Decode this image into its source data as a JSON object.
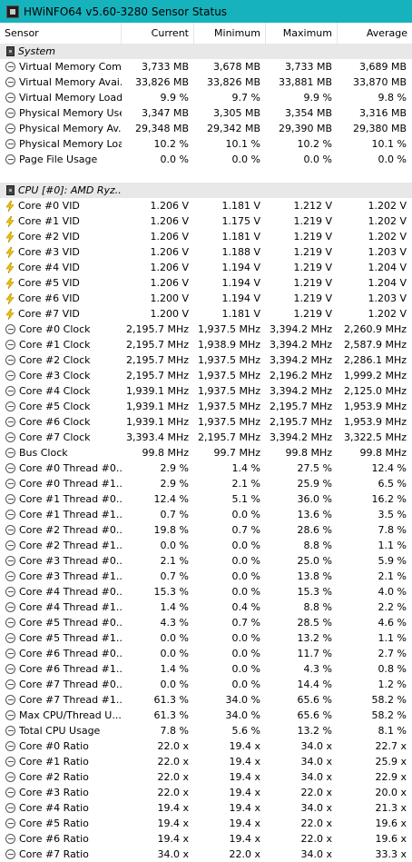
{
  "window": {
    "title": "HWiNFO64 v5.60-3280 Sensor Status"
  },
  "columns": {
    "sensor": "Sensor",
    "current": "Current",
    "minimum": "Minimum",
    "maximum": "Maximum",
    "average": "Average"
  },
  "rows": [
    {
      "kind": "group",
      "icon": "chip-icon",
      "name": "System",
      "cur": "",
      "min": "",
      "max": "",
      "avg": ""
    },
    {
      "kind": "item",
      "icon": "gauge-icon",
      "name": "Virtual Memory Com...",
      "cur": "3,733 MB",
      "min": "3,678 MB",
      "max": "3,733 MB",
      "avg": "3,689 MB"
    },
    {
      "kind": "item",
      "icon": "gauge-icon",
      "name": "Virtual Memory Avai...",
      "cur": "33,826 MB",
      "min": "33,826 MB",
      "max": "33,881 MB",
      "avg": "33,870 MB"
    },
    {
      "kind": "item",
      "icon": "gauge-icon",
      "name": "Virtual Memory Load",
      "cur": "9.9 %",
      "min": "9.7 %",
      "max": "9.9 %",
      "avg": "9.8 %"
    },
    {
      "kind": "item",
      "icon": "gauge-icon",
      "name": "Physical Memory Used",
      "cur": "3,347 MB",
      "min": "3,305 MB",
      "max": "3,354 MB",
      "avg": "3,316 MB"
    },
    {
      "kind": "item",
      "icon": "gauge-icon",
      "name": "Physical Memory Av...",
      "cur": "29,348 MB",
      "min": "29,342 MB",
      "max": "29,390 MB",
      "avg": "29,380 MB"
    },
    {
      "kind": "item",
      "icon": "gauge-icon",
      "name": "Physical Memory Load",
      "cur": "10.2 %",
      "min": "10.1 %",
      "max": "10.2 %",
      "avg": "10.1 %"
    },
    {
      "kind": "item",
      "icon": "gauge-icon",
      "name": "Page File Usage",
      "cur": "0.0 %",
      "min": "0.0 %",
      "max": "0.0 %",
      "avg": "0.0 %"
    },
    {
      "kind": "blank",
      "icon": "",
      "name": "",
      "cur": "",
      "min": "",
      "max": "",
      "avg": ""
    },
    {
      "kind": "group",
      "icon": "chip-icon",
      "name": "CPU [#0]: AMD Ryz...",
      "cur": "",
      "min": "",
      "max": "",
      "avg": ""
    },
    {
      "kind": "item",
      "icon": "bolt-icon",
      "name": "Core #0 VID",
      "cur": "1.206 V",
      "min": "1.181 V",
      "max": "1.212 V",
      "avg": "1.202 V"
    },
    {
      "kind": "item",
      "icon": "bolt-icon",
      "name": "Core #1 VID",
      "cur": "1.206 V",
      "min": "1.175 V",
      "max": "1.219 V",
      "avg": "1.202 V"
    },
    {
      "kind": "item",
      "icon": "bolt-icon",
      "name": "Core #2 VID",
      "cur": "1.206 V",
      "min": "1.181 V",
      "max": "1.219 V",
      "avg": "1.202 V"
    },
    {
      "kind": "item",
      "icon": "bolt-icon",
      "name": "Core #3 VID",
      "cur": "1.206 V",
      "min": "1.188 V",
      "max": "1.219 V",
      "avg": "1.203 V"
    },
    {
      "kind": "item",
      "icon": "bolt-icon",
      "name": "Core #4 VID",
      "cur": "1.206 V",
      "min": "1.194 V",
      "max": "1.219 V",
      "avg": "1.204 V"
    },
    {
      "kind": "item",
      "icon": "bolt-icon",
      "name": "Core #5 VID",
      "cur": "1.206 V",
      "min": "1.194 V",
      "max": "1.219 V",
      "avg": "1.204 V"
    },
    {
      "kind": "item",
      "icon": "bolt-icon",
      "name": "Core #6 VID",
      "cur": "1.200 V",
      "min": "1.194 V",
      "max": "1.219 V",
      "avg": "1.203 V"
    },
    {
      "kind": "item",
      "icon": "bolt-icon",
      "name": "Core #7 VID",
      "cur": "1.200 V",
      "min": "1.181 V",
      "max": "1.219 V",
      "avg": "1.202 V"
    },
    {
      "kind": "item",
      "icon": "gauge-icon",
      "name": "Core #0 Clock",
      "cur": "2,195.7 MHz",
      "min": "1,937.5 MHz",
      "max": "3,394.2 MHz",
      "avg": "2,260.9 MHz"
    },
    {
      "kind": "item",
      "icon": "gauge-icon",
      "name": "Core #1 Clock",
      "cur": "2,195.7 MHz",
      "min": "1,938.9 MHz",
      "max": "3,394.2 MHz",
      "avg": "2,587.9 MHz"
    },
    {
      "kind": "item",
      "icon": "gauge-icon",
      "name": "Core #2 Clock",
      "cur": "2,195.7 MHz",
      "min": "1,937.5 MHz",
      "max": "3,394.2 MHz",
      "avg": "2,286.1 MHz"
    },
    {
      "kind": "item",
      "icon": "gauge-icon",
      "name": "Core #3 Clock",
      "cur": "2,195.7 MHz",
      "min": "1,937.5 MHz",
      "max": "2,196.2 MHz",
      "avg": "1,999.2 MHz"
    },
    {
      "kind": "item",
      "icon": "gauge-icon",
      "name": "Core #4 Clock",
      "cur": "1,939.1 MHz",
      "min": "1,937.5 MHz",
      "max": "3,394.2 MHz",
      "avg": "2,125.0 MHz"
    },
    {
      "kind": "item",
      "icon": "gauge-icon",
      "name": "Core #5 Clock",
      "cur": "1,939.1 MHz",
      "min": "1,937.5 MHz",
      "max": "2,195.7 MHz",
      "avg": "1,953.9 MHz"
    },
    {
      "kind": "item",
      "icon": "gauge-icon",
      "name": "Core #6 Clock",
      "cur": "1,939.1 MHz",
      "min": "1,937.5 MHz",
      "max": "2,195.7 MHz",
      "avg": "1,953.9 MHz"
    },
    {
      "kind": "item",
      "icon": "gauge-icon",
      "name": "Core #7 Clock",
      "cur": "3,393.4 MHz",
      "min": "2,195.7 MHz",
      "max": "3,394.2 MHz",
      "avg": "3,322.5 MHz"
    },
    {
      "kind": "item",
      "icon": "gauge-icon",
      "name": "Bus Clock",
      "cur": "99.8 MHz",
      "min": "99.7 MHz",
      "max": "99.8 MHz",
      "avg": "99.8 MHz"
    },
    {
      "kind": "item",
      "icon": "gauge-icon",
      "name": "Core #0 Thread #0...",
      "cur": "2.9 %",
      "min": "1.4 %",
      "max": "27.5 %",
      "avg": "12.4 %"
    },
    {
      "kind": "item",
      "icon": "gauge-icon",
      "name": "Core #0 Thread #1...",
      "cur": "2.9 %",
      "min": "2.1 %",
      "max": "25.9 %",
      "avg": "6.5 %"
    },
    {
      "kind": "item",
      "icon": "gauge-icon",
      "name": "Core #1 Thread #0...",
      "cur": "12.4 %",
      "min": "5.1 %",
      "max": "36.0 %",
      "avg": "16.2 %"
    },
    {
      "kind": "item",
      "icon": "gauge-icon",
      "name": "Core #1 Thread #1...",
      "cur": "0.7 %",
      "min": "0.0 %",
      "max": "13.6 %",
      "avg": "3.5 %"
    },
    {
      "kind": "item",
      "icon": "gauge-icon",
      "name": "Core #2 Thread #0...",
      "cur": "19.8 %",
      "min": "0.7 %",
      "max": "28.6 %",
      "avg": "7.8 %"
    },
    {
      "kind": "item",
      "icon": "gauge-icon",
      "name": "Core #2 Thread #1...",
      "cur": "0.0 %",
      "min": "0.0 %",
      "max": "8.8 %",
      "avg": "1.1 %"
    },
    {
      "kind": "item",
      "icon": "gauge-icon",
      "name": "Core #3 Thread #0...",
      "cur": "2.1 %",
      "min": "0.0 %",
      "max": "25.0 %",
      "avg": "5.9 %"
    },
    {
      "kind": "item",
      "icon": "gauge-icon",
      "name": "Core #3 Thread #1...",
      "cur": "0.7 %",
      "min": "0.0 %",
      "max": "13.8 %",
      "avg": "2.1 %"
    },
    {
      "kind": "item",
      "icon": "gauge-icon",
      "name": "Core #4 Thread #0...",
      "cur": "15.3 %",
      "min": "0.0 %",
      "max": "15.3 %",
      "avg": "4.0 %"
    },
    {
      "kind": "item",
      "icon": "gauge-icon",
      "name": "Core #4 Thread #1...",
      "cur": "1.4 %",
      "min": "0.4 %",
      "max": "8.8 %",
      "avg": "2.2 %"
    },
    {
      "kind": "item",
      "icon": "gauge-icon",
      "name": "Core #5 Thread #0...",
      "cur": "4.3 %",
      "min": "0.7 %",
      "max": "28.5 %",
      "avg": "4.6 %"
    },
    {
      "kind": "item",
      "icon": "gauge-icon",
      "name": "Core #5 Thread #1...",
      "cur": "0.0 %",
      "min": "0.0 %",
      "max": "13.2 %",
      "avg": "1.1 %"
    },
    {
      "kind": "item",
      "icon": "gauge-icon",
      "name": "Core #6 Thread #0...",
      "cur": "0.0 %",
      "min": "0.0 %",
      "max": "11.7 %",
      "avg": "2.7 %"
    },
    {
      "kind": "item",
      "icon": "gauge-icon",
      "name": "Core #6 Thread #1...",
      "cur": "1.4 %",
      "min": "0.0 %",
      "max": "4.3 %",
      "avg": "0.8 %"
    },
    {
      "kind": "item",
      "icon": "gauge-icon",
      "name": "Core #7 Thread #0...",
      "cur": "0.0 %",
      "min": "0.0 %",
      "max": "14.4 %",
      "avg": "1.2 %"
    },
    {
      "kind": "item",
      "icon": "gauge-icon",
      "name": "Core #7 Thread #1...",
      "cur": "61.3 %",
      "min": "34.0 %",
      "max": "65.6 %",
      "avg": "58.2 %"
    },
    {
      "kind": "item",
      "icon": "gauge-icon",
      "name": "Max CPU/Thread U...",
      "cur": "61.3 %",
      "min": "34.0 %",
      "max": "65.6 %",
      "avg": "58.2 %"
    },
    {
      "kind": "item",
      "icon": "gauge-icon",
      "name": "Total CPU Usage",
      "cur": "7.8 %",
      "min": "5.6 %",
      "max": "13.2 %",
      "avg": "8.1 %"
    },
    {
      "kind": "item",
      "icon": "gauge-icon",
      "name": "Core #0 Ratio",
      "cur": "22.0 x",
      "min": "19.4 x",
      "max": "34.0 x",
      "avg": "22.7 x"
    },
    {
      "kind": "item",
      "icon": "gauge-icon",
      "name": "Core #1 Ratio",
      "cur": "22.0 x",
      "min": "19.4 x",
      "max": "34.0 x",
      "avg": "25.9 x"
    },
    {
      "kind": "item",
      "icon": "gauge-icon",
      "name": "Core #2 Ratio",
      "cur": "22.0 x",
      "min": "19.4 x",
      "max": "34.0 x",
      "avg": "22.9 x"
    },
    {
      "kind": "item",
      "icon": "gauge-icon",
      "name": "Core #3 Ratio",
      "cur": "22.0 x",
      "min": "19.4 x",
      "max": "22.0 x",
      "avg": "20.0 x"
    },
    {
      "kind": "item",
      "icon": "gauge-icon",
      "name": "Core #4 Ratio",
      "cur": "19.4 x",
      "min": "19.4 x",
      "max": "34.0 x",
      "avg": "21.3 x"
    },
    {
      "kind": "item",
      "icon": "gauge-icon",
      "name": "Core #5 Ratio",
      "cur": "19.4 x",
      "min": "19.4 x",
      "max": "22.0 x",
      "avg": "19.6 x"
    },
    {
      "kind": "item",
      "icon": "gauge-icon",
      "name": "Core #6 Ratio",
      "cur": "19.4 x",
      "min": "19.4 x",
      "max": "22.0 x",
      "avg": "19.6 x"
    },
    {
      "kind": "item",
      "icon": "gauge-icon",
      "name": "Core #7 Ratio",
      "cur": "34.0 x",
      "min": "22.0 x",
      "max": "34.0 x",
      "avg": "33.3 x"
    }
  ],
  "colors": {
    "titlebar": "#17b3bd",
    "group_row": "#e8e8e8",
    "bolt": "#f2c200"
  }
}
